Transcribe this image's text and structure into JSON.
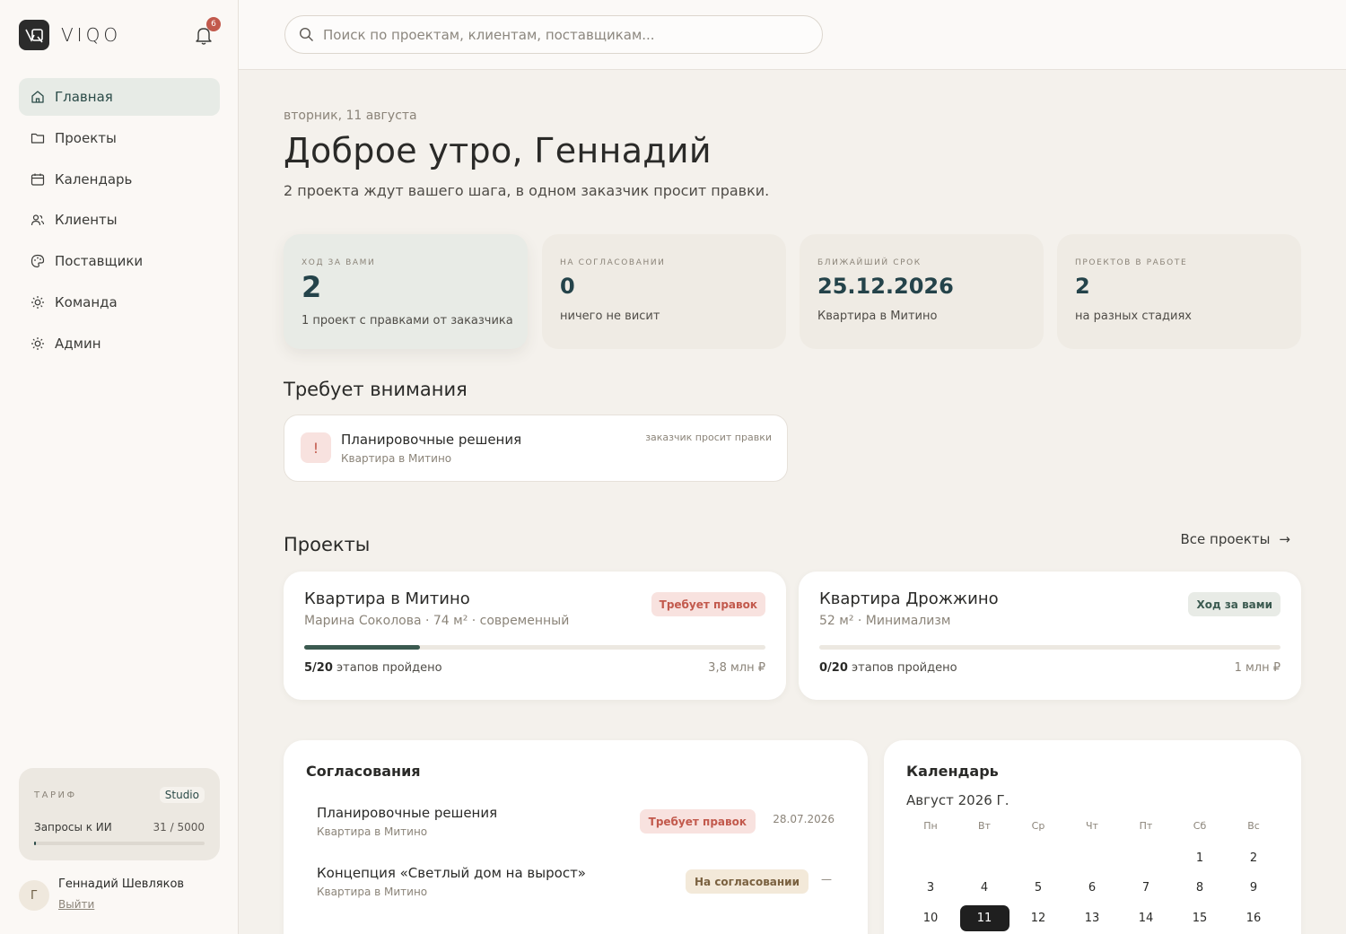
{
  "app": {
    "brand": "VIQO",
    "notifications_count": "6"
  },
  "sidebar": {
    "items": [
      {
        "label": "Главная",
        "icon": "home-icon",
        "active": true
      },
      {
        "label": "Проекты",
        "icon": "folder-icon"
      },
      {
        "label": "Календарь",
        "icon": "calendar-icon"
      },
      {
        "label": "Клиенты",
        "icon": "users-icon"
      },
      {
        "label": "Поставщики",
        "icon": "palette-icon"
      },
      {
        "label": "Команда",
        "icon": "sun-icon"
      },
      {
        "label": "Админ",
        "icon": "sun-icon"
      }
    ],
    "tariff": {
      "label": "ТАРИФ",
      "plan": "Studio",
      "ai_label": "Запросы к ИИ",
      "ai_value": "31 / 5000",
      "ai_used_fraction": 0.0062
    },
    "user": {
      "initial": "Г",
      "name": "Геннадий Шевляков",
      "logout": "Выйти"
    }
  },
  "search": {
    "placeholder": "Поиск по проектам, клиентам, поставщикам..."
  },
  "header": {
    "date": "вторник, 11 августа",
    "greeting": "Доброе утро, Геннадий",
    "subtitle": "2 проекта ждут вашего шага, в одном заказчик просит правки."
  },
  "stats": [
    {
      "label": "ХОД ЗА ВАМИ",
      "value": "2",
      "desc": "1 проект с правками от заказчика"
    },
    {
      "label": "НА СОГЛАСОВАНИИ",
      "value": "0",
      "desc": "ничего не висит"
    },
    {
      "label": "БЛИЖАЙШИЙ СРОК",
      "value": "25.12.2026",
      "desc": "Квартира в Митино"
    },
    {
      "label": "ПРОЕКТОВ В РАБОТЕ",
      "value": "2",
      "desc": "на разных стадиях"
    }
  ],
  "attention": {
    "title": "Требует внимания",
    "item": {
      "icon": "!",
      "title": "Планировочные решения",
      "sub": "Квартира в Митино",
      "tag": "заказчик просит правки"
    }
  },
  "projects": {
    "title": "Проекты",
    "all_link": "Все проекты",
    "items": [
      {
        "title": "Квартира в Митино",
        "meta": "Марина Соколова · 74 м² · современный",
        "badge": "Требует правок",
        "steps_done": "5/20",
        "steps_label": "этапов пройдено",
        "progress": 0.25,
        "budget": "3,8 млн ₽"
      },
      {
        "title": "Квартира Дрожжино",
        "meta": "52 м² · Минимализм",
        "badge": "Ход за вами",
        "steps_done": "0/20",
        "steps_label": "этапов пройдено",
        "progress": 0,
        "budget": "1 млн ₽"
      }
    ]
  },
  "approvals": {
    "title": "Согласования",
    "items": [
      {
        "name": "Планировочные решения",
        "sub": "Квартира в Митино",
        "badge": "Требует правок",
        "date": "28.07.2026"
      },
      {
        "name": "Концепция «Светлый дом на вырост»",
        "sub": "Квартира в Митино",
        "badge": "На согласовании",
        "date": "—"
      }
    ]
  },
  "calendar": {
    "title": "Календарь",
    "month": "Август 2026 Г.",
    "weekdays": [
      "Пн",
      "Вт",
      "Ср",
      "Чт",
      "Пт",
      "Сб",
      "Вс"
    ],
    "weeks": [
      [
        "",
        "",
        "",
        "",
        "",
        "1",
        "2"
      ],
      [
        "3",
        "4",
        "5",
        "6",
        "7",
        "8",
        "9"
      ],
      [
        "10",
        "11",
        "12",
        "13",
        "14",
        "15",
        "16"
      ]
    ],
    "today": "11"
  },
  "colors": {
    "accent": "#2b4b48",
    "danger": "#c2594c",
    "background": "#f4f1ec"
  }
}
